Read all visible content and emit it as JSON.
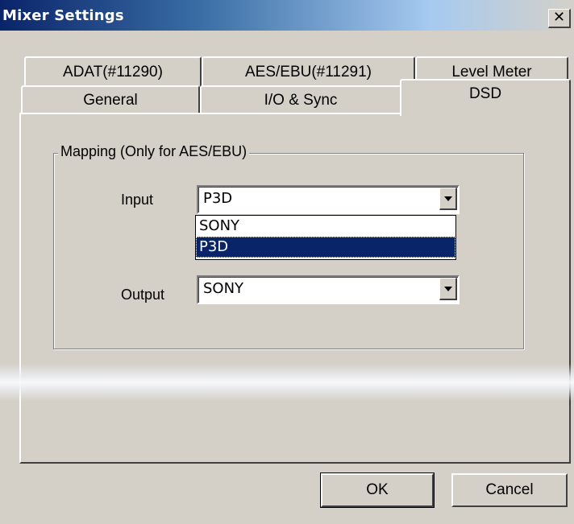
{
  "window": {
    "title": "Mixer Settings",
    "close_glyph": "✕"
  },
  "tabs": {
    "row_back": [
      {
        "label": "ADAT(#11290)"
      },
      {
        "label": "AES/EBU(#11291)"
      },
      {
        "label": "Level Meter"
      }
    ],
    "row_front": [
      {
        "label": "General"
      },
      {
        "label": "I/O & Sync"
      },
      {
        "label": "DSD",
        "active": true
      }
    ]
  },
  "mapping": {
    "group_label": "Mapping (Only for AES/EBU)",
    "input_label": "Input",
    "input_value": "P3D",
    "input_options": [
      "SONY",
      "P3D"
    ],
    "input_selected_option": "P3D",
    "output_label": "Output",
    "output_value": "SONY"
  },
  "buttons": {
    "ok": "OK",
    "cancel": "Cancel"
  },
  "colors": {
    "dialog_face": "#d4d0c8",
    "titlebar_start": "#0a246a",
    "titlebar_end": "#a6caf0",
    "selection": "#0a246a"
  },
  "icons": {
    "close": "close-icon",
    "dropdown": "chevron-down-icon"
  }
}
